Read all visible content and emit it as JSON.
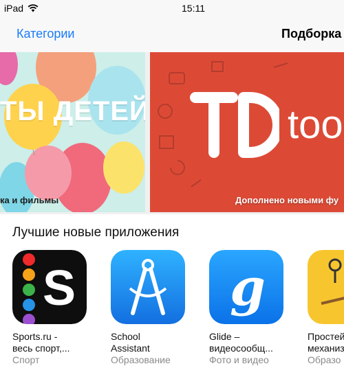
{
  "status_bar": {
    "device": "iPad",
    "time": "15:11"
  },
  "nav": {
    "back_label": "Категории",
    "title": "Подборка"
  },
  "banners": [
    {
      "headline": "ТЫ ДЕТЕЙ",
      "caption": "ка и фильмы"
    },
    {
      "logo_text": "too",
      "caption": "Дополнено новыми фу"
    }
  ],
  "section": {
    "title": "Лучшие новые приложения"
  },
  "apps": [
    {
      "name_line1": "Sports.ru -",
      "name_line2": "весь спорт,...",
      "category": "Спорт"
    },
    {
      "name_line1": "School",
      "name_line2": "Assistant",
      "category": "Образование"
    },
    {
      "name_line1": "Glide –",
      "name_line2": "видеосообщ...",
      "category": "Фото и видео"
    },
    {
      "name_line1": "Простей",
      "name_line2": "механиз",
      "category": "Образо"
    }
  ]
}
